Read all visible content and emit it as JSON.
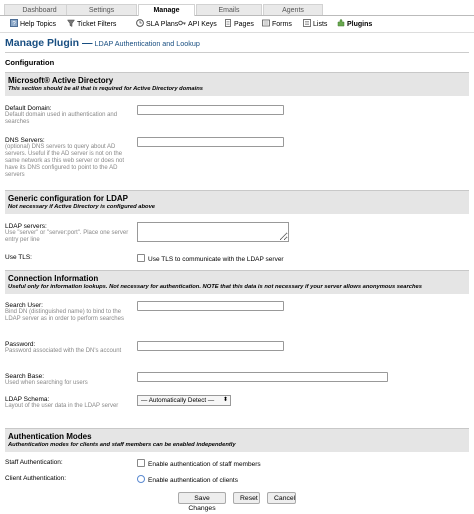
{
  "topnav": {
    "tabs": [
      {
        "label": "Dashboard"
      },
      {
        "label": "Settings"
      },
      {
        "label": "Manage"
      },
      {
        "label": "Emails"
      },
      {
        "label": "Agents"
      }
    ]
  },
  "subnav": {
    "items": [
      {
        "label": "Help Topics",
        "icon": "help-topics-icon"
      },
      {
        "label": "Ticket Filters",
        "icon": "ticket-filters-icon"
      },
      {
        "label": "SLA Plans",
        "icon": "sla-plans-icon"
      },
      {
        "label": "API Keys",
        "icon": "api-keys-icon"
      },
      {
        "label": "Pages",
        "icon": "pages-icon"
      },
      {
        "label": "Forms",
        "icon": "forms-icon"
      },
      {
        "label": "Lists",
        "icon": "lists-icon"
      },
      {
        "label": "Plugins",
        "icon": "plugins-icon"
      }
    ]
  },
  "page": {
    "title": "Manage Plugin —",
    "subtitle": "LDAP Authentication and Lookup",
    "configuration": "Configuration"
  },
  "sections": {
    "ad": {
      "heading": "Microsoft® Active Directory",
      "desc": "This section should be all that is required for Active Directory domains"
    },
    "ldap": {
      "heading": "Generic configuration for LDAP",
      "desc": "Not necessary if Active Directory is configured above"
    },
    "conn": {
      "heading": "Connection Information",
      "desc": "Useful only for information lookups. Not necessary for authentication. NOTE that this data is not necessary if your server allows anonymous searches"
    },
    "auth": {
      "heading": "Authentication Modes",
      "desc": "Authentication modes for clients and staff members can be enabled independently"
    }
  },
  "fields": {
    "default_domain": {
      "label": "Default Domain:",
      "hint": "Default domain used in authentication and searches",
      "value": ""
    },
    "dns_servers": {
      "label": "DNS Servers:",
      "hint": "(optional) DNS servers to query about AD servers. Useful if the AD server is not on the same network as this web server or does not have its DNS configured to point to the AD servers",
      "value": ""
    },
    "ldap_servers": {
      "label": "LDAP servers:",
      "hint": "Use \"server\" or \"server:port\". Place one server entry per line",
      "value": ""
    },
    "use_tls": {
      "label": "Use TLS:",
      "option": "Use TLS to communicate with the LDAP server"
    },
    "search_user": {
      "label": "Search User:",
      "hint": "Bind DN (distinguished name) to bind to the LDAP server as in order to perform searches",
      "value": ""
    },
    "password": {
      "label": "Password:",
      "hint": "Password associated with the DN's account",
      "value": ""
    },
    "search_base": {
      "label": "Search Base:",
      "hint": "Used when searching for users",
      "value": ""
    },
    "ldap_schema": {
      "label": "LDAP Schema:",
      "hint": "Layout of the user data in the LDAP server",
      "selected": "— Automatically Detect —"
    },
    "staff_auth": {
      "label": "Staff Authentication:",
      "option": "Enable authentication of staff members"
    },
    "client_auth": {
      "label": "Client Authentication:",
      "option": "Enable authentication of clients"
    }
  },
  "buttons": {
    "save": "Save Changes",
    "reset": "Reset",
    "cancel": "Cancel"
  },
  "colors": {
    "title": "#184e81",
    "section_bg": "#e5e5e5"
  }
}
